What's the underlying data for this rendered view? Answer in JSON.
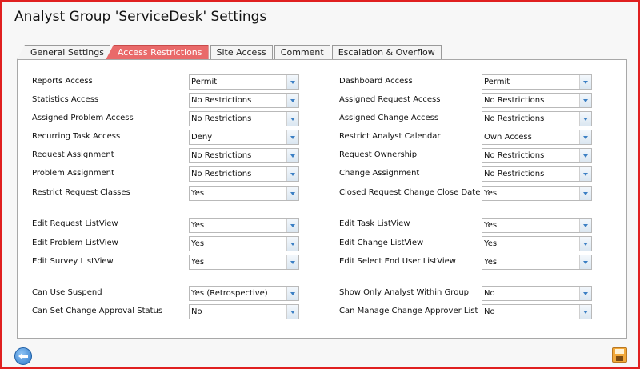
{
  "window": {
    "title": "Analyst Group 'ServiceDesk' Settings"
  },
  "tabs": [
    {
      "label": "General Settings",
      "active": false
    },
    {
      "label": "Access Restrictions",
      "active": true
    },
    {
      "label": "Site Access",
      "active": false
    },
    {
      "label": "Comment",
      "active": false
    },
    {
      "label": "Escalation & Overflow",
      "active": false
    }
  ],
  "left_fields": [
    {
      "label": "Reports Access",
      "value": "Permit"
    },
    {
      "label": "Statistics Access",
      "value": "No Restrictions"
    },
    {
      "label": "Assigned Problem Access",
      "value": "No Restrictions"
    },
    {
      "label": "Recurring Task Access",
      "value": "Deny"
    },
    {
      "label": "Request Assignment",
      "value": "No Restrictions"
    },
    {
      "label": "Problem Assignment",
      "value": "No Restrictions"
    },
    {
      "label": "Restrict Request Classes",
      "value": "Yes"
    },
    {
      "label": "Edit Request ListView",
      "value": "Yes"
    },
    {
      "label": "Edit Problem ListView",
      "value": "Yes"
    },
    {
      "label": "Edit Survey ListView",
      "value": "Yes"
    },
    {
      "label": "Can Use Suspend",
      "value": "Yes (Retrospective)"
    },
    {
      "label": "Can Set Change Approval Status",
      "value": "No"
    }
  ],
  "right_fields": [
    {
      "label": "Dashboard Access",
      "value": "Permit"
    },
    {
      "label": "Assigned Request Access",
      "value": "No Restrictions"
    },
    {
      "label": "Assigned Change Access",
      "value": "No Restrictions"
    },
    {
      "label": "Restrict Analyst Calendar",
      "value": "Own Access"
    },
    {
      "label": "Request Ownership",
      "value": "No Restrictions"
    },
    {
      "label": "Change Assignment",
      "value": "No Restrictions"
    },
    {
      "label": "Closed Request Change Close Date",
      "value": "Yes"
    },
    {
      "label": "Edit Task ListView",
      "value": "Yes"
    },
    {
      "label": "Edit Change ListView",
      "value": "Yes"
    },
    {
      "label": "Edit Select End User ListView",
      "value": "Yes"
    },
    {
      "label": "Show Only Analyst Within Group",
      "value": "No"
    },
    {
      "label": "Can Manage Change Approver List",
      "value": "No"
    }
  ],
  "icons": {
    "back": "back-arrow-icon",
    "save": "save-icon"
  },
  "colors": {
    "window_border": "#e02020",
    "active_tab": "#e96a6a",
    "dropdown_arrow": "#3b7fc4"
  }
}
